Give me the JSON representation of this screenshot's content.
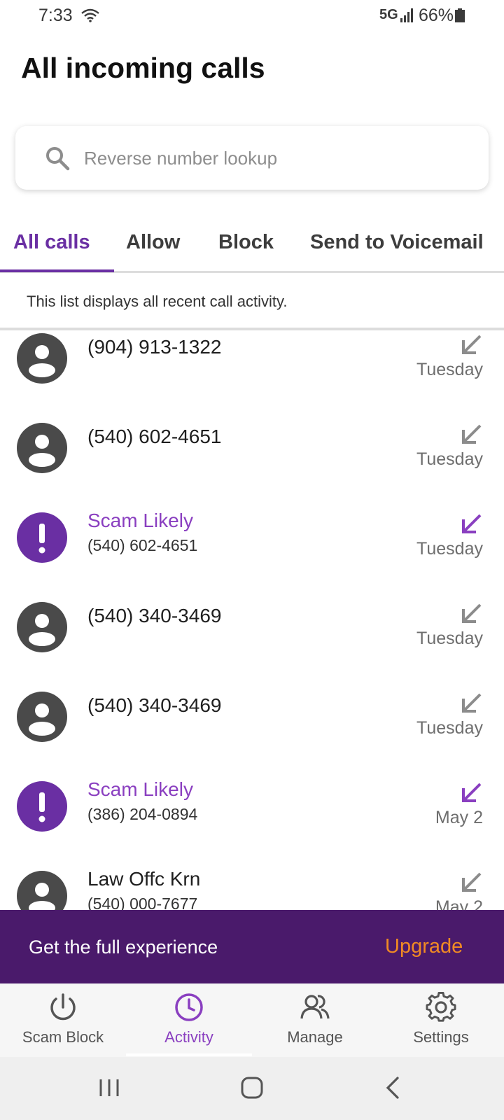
{
  "status_bar": {
    "time": "7:33",
    "network": "5G",
    "battery": "66%"
  },
  "title": "All incoming calls",
  "search": {
    "placeholder": "Reverse number lookup"
  },
  "tabs": [
    {
      "label": "All calls",
      "active": true
    },
    {
      "label": "Allow",
      "active": false
    },
    {
      "label": "Block",
      "active": false
    },
    {
      "label": "Send to Voicemail",
      "active": false
    }
  ],
  "info_text": "This list displays all recent call activity.",
  "calls": [
    {
      "primary": "(904) 913-1322",
      "secondary": "",
      "date": "Tuesday",
      "scam": false
    },
    {
      "primary": "(540) 602-4651",
      "secondary": "",
      "date": "Tuesday",
      "scam": false
    },
    {
      "primary": "Scam Likely",
      "secondary": "(540) 602-4651",
      "date": "Tuesday",
      "scam": true
    },
    {
      "primary": "(540) 340-3469",
      "secondary": "",
      "date": "Tuesday",
      "scam": false
    },
    {
      "primary": "(540) 340-3469",
      "secondary": "",
      "date": "Tuesday",
      "scam": false
    },
    {
      "primary": "Scam Likely",
      "secondary": "(386) 204-0894",
      "date": "May 2",
      "scam": true
    },
    {
      "primary": "Law Offc Krn",
      "secondary": "(540) 000-7677",
      "date": "May 2",
      "scam": false
    }
  ],
  "banner": {
    "text": "Get the full experience",
    "button": "Upgrade"
  },
  "bottom_nav": [
    {
      "label": "Scam Block",
      "icon": "power-icon",
      "active": false
    },
    {
      "label": "Activity",
      "icon": "clock-icon",
      "active": true
    },
    {
      "label": "Manage",
      "icon": "people-icon",
      "active": false
    },
    {
      "label": "Settings",
      "icon": "gear-icon",
      "active": false
    }
  ],
  "colors": {
    "accent": "#6a2fa3",
    "scam": "#8a3fc0",
    "banner": "#4a1a6b",
    "upgrade": "#f08a24"
  }
}
